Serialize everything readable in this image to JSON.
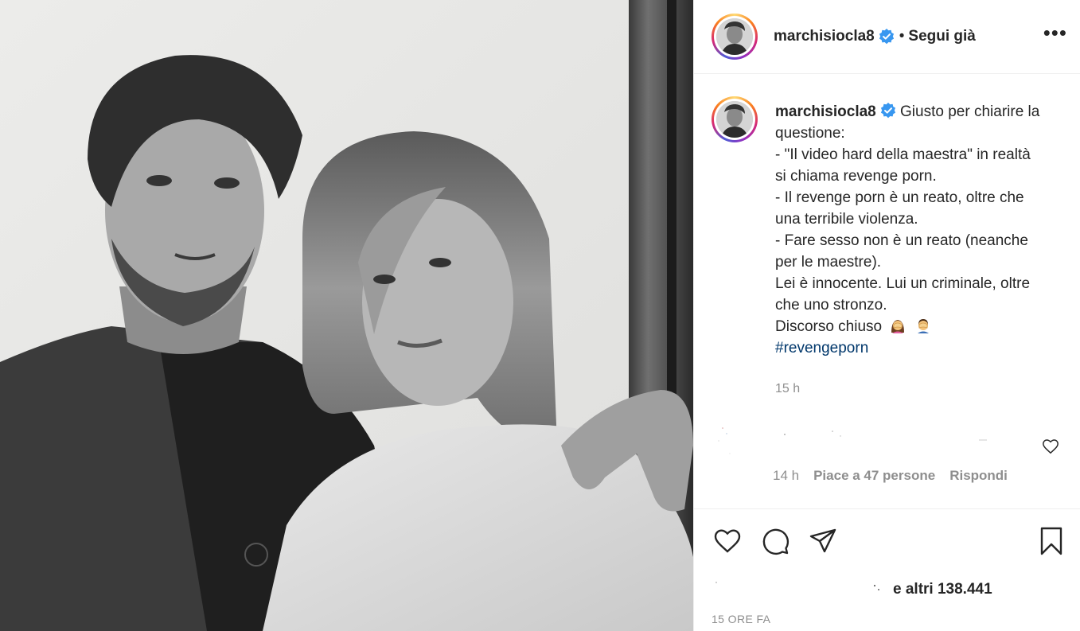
{
  "header": {
    "username": "marchisiocla8",
    "separator": "•",
    "follow_state": "Segui già",
    "more_label": "•••"
  },
  "caption": {
    "username": "marchisiocla8",
    "lines": [
      "Giusto per chiarire la",
      "questione:",
      "- \"Il video hard della maestra\" in realtà",
      "si chiama revenge porn.",
      "- Il revenge porn è un reato, oltre che",
      "una terribile violenza.",
      "- Fare sesso non è un reato (neanche",
      "per le maestre).",
      "Lei è innocente. Lui un criminale, oltre",
      "che uno stronzo.",
      "Discorso chiuso"
    ],
    "hashtag": "#revengeporn",
    "time": "15 h"
  },
  "reply": {
    "time": "14 h",
    "likes": "Piace a 47 persone",
    "reply_label": "Rispondi"
  },
  "likes_summary": {
    "text": "e altri 138.441"
  },
  "post_time": "15 ORE FA",
  "icons": {
    "like": "heart-icon",
    "comment": "comment-icon",
    "share": "send-icon",
    "save": "bookmark-icon",
    "verified": "verified-badge-icon"
  },
  "colors": {
    "verified": "#3897f0",
    "text": "#262626",
    "muted": "#8e8e8e",
    "hashtag": "#00376b",
    "border": "#efefef"
  }
}
